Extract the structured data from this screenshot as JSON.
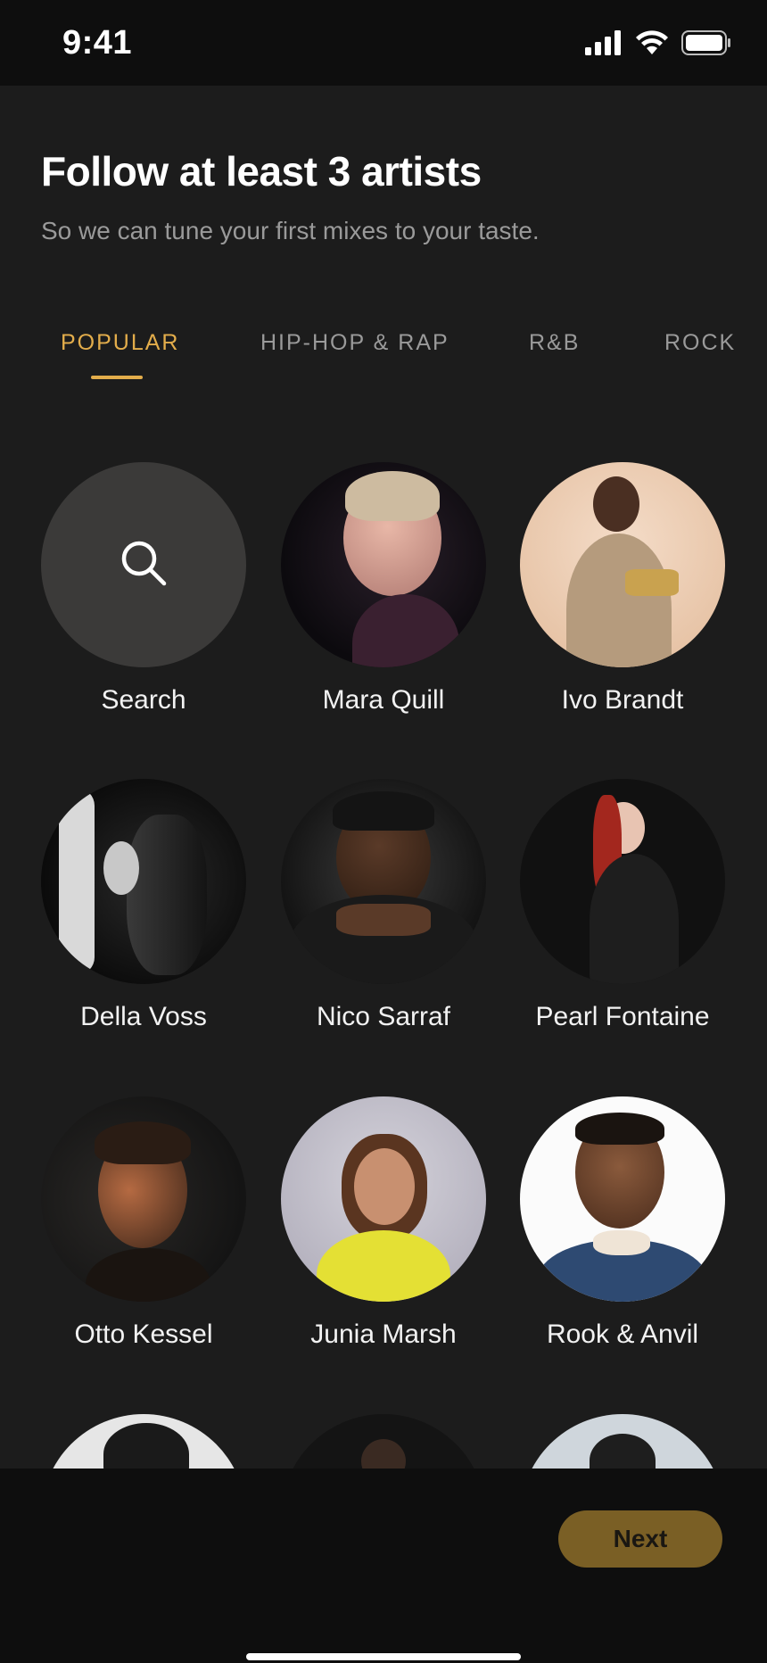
{
  "status_bar": {
    "time": "9:41"
  },
  "header": {
    "title": "Follow at least 3 artists",
    "subtitle": "So we can tune your first mixes to your taste."
  },
  "tabs": [
    {
      "label": "POPULAR",
      "active": true
    },
    {
      "label": "HIP-HOP & RAP",
      "active": false
    },
    {
      "label": "R&B",
      "active": false
    },
    {
      "label": "ROCK",
      "active": false
    }
  ],
  "grid": {
    "search_label": "Search",
    "artists": [
      "Mara Quill",
      "Ivo Brandt",
      "Della Voss",
      "Nico Sarraf",
      "Pearl Fontaine",
      "Otto Kessel",
      "Junia Marsh",
      "Rook & Anvil"
    ]
  },
  "footer": {
    "next_label": "Next"
  },
  "colors": {
    "accent": "#e3ad4b",
    "background": "#1c1c1c",
    "bar_background": "#0e0e0e",
    "next_button": "#7a5f25",
    "muted_text": "#9a9a9a"
  }
}
